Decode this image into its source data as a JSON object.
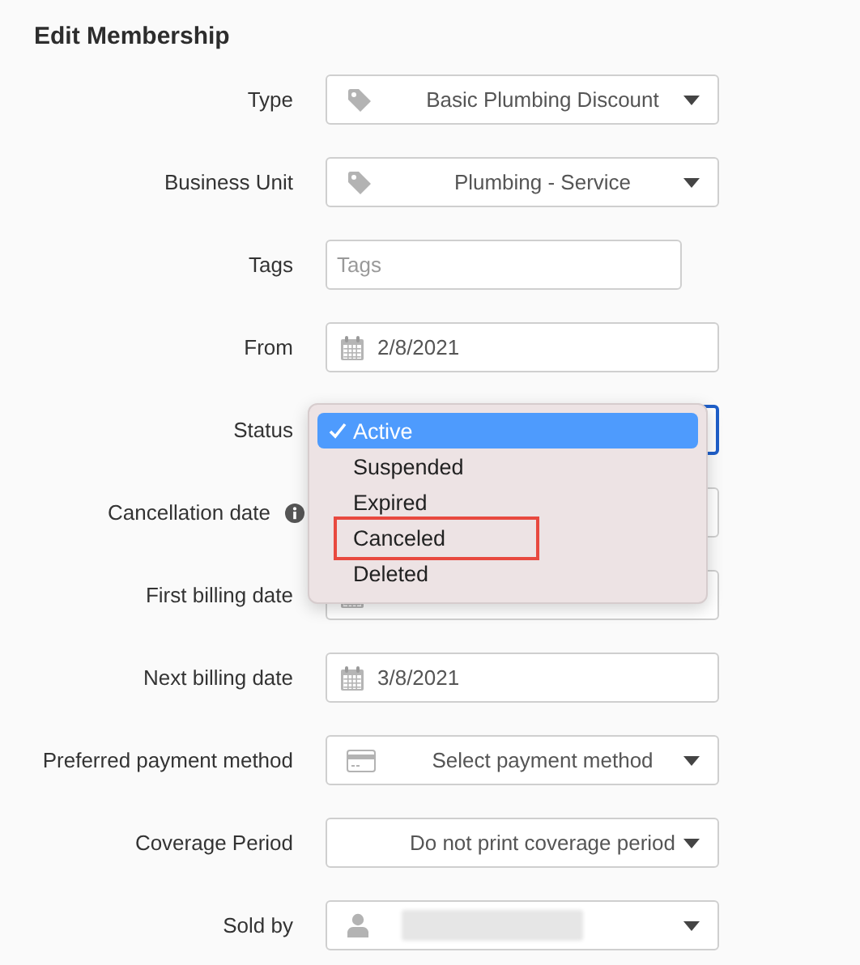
{
  "title": "Edit Membership",
  "fields": [
    {
      "label": "Type",
      "kind": "tag-select",
      "value": "Basic Plumbing Discount"
    },
    {
      "label": "Business Unit",
      "kind": "tag-select",
      "value": "Plumbing - Service"
    },
    {
      "label": "Tags",
      "kind": "text",
      "placeholder": "Tags"
    },
    {
      "label": "From",
      "kind": "date",
      "value": "2/8/2021"
    },
    {
      "label": "Status",
      "kind": "open-select",
      "focused": true,
      "options": [
        {
          "label": "Active",
          "selected": true,
          "outlined": false
        },
        {
          "label": "Suspended",
          "selected": false,
          "outlined": false
        },
        {
          "label": "Expired",
          "selected": false,
          "outlined": false
        },
        {
          "label": "Canceled",
          "selected": false,
          "outlined": true
        },
        {
          "label": "Deleted",
          "selected": false,
          "outlined": false
        }
      ]
    },
    {
      "label": "Cancellation date",
      "kind": "covered-field",
      "info": true
    },
    {
      "label": "First billing date",
      "kind": "date"
    },
    {
      "label": "Next billing date",
      "kind": "date",
      "value": "3/8/2021"
    },
    {
      "label": "Preferred payment method",
      "kind": "card-select",
      "value": "Select payment method"
    },
    {
      "label": "Coverage Period",
      "kind": "plain-select",
      "value": "Do not print coverage period"
    },
    {
      "label": "Sold by",
      "kind": "person-select",
      "redacted": true
    }
  ]
}
